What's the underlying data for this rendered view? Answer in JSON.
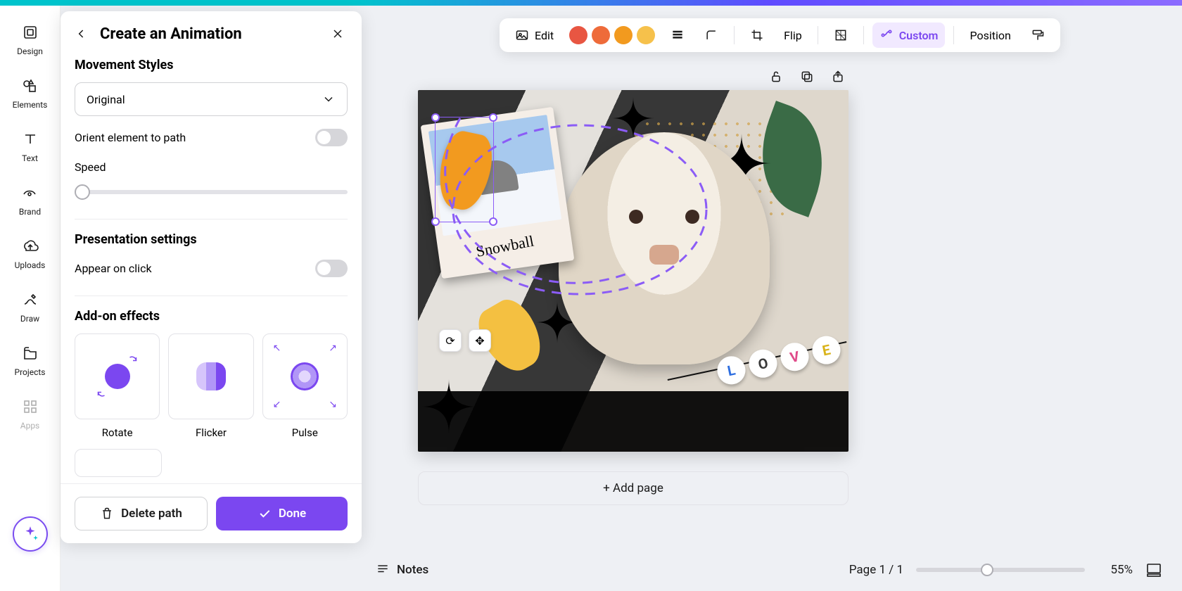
{
  "rail": {
    "design": "Design",
    "elements": "Elements",
    "text": "Text",
    "brand": "Brand",
    "uploads": "Uploads",
    "draw": "Draw",
    "projects": "Projects",
    "apps": "Apps"
  },
  "panel": {
    "title": "Create an Animation",
    "movement_styles": "Movement Styles",
    "style_selected": "Original",
    "orient_label": "Orient element to path",
    "speed_label": "Speed",
    "presentation_settings": "Presentation settings",
    "appear_on_click": "Appear on click",
    "addon_effects": "Add-on effects",
    "effects": {
      "rotate": "Rotate",
      "flicker": "Flicker",
      "pulse": "Pulse"
    },
    "delete_path": "Delete path",
    "done": "Done"
  },
  "context_bar": {
    "edit": "Edit",
    "swatches": [
      "#e85642",
      "#ee6b3a",
      "#f29a1f",
      "#f6c14b"
    ],
    "flip": "Flip",
    "custom": "Custom",
    "position": "Position"
  },
  "canvas": {
    "polaroid_caption": "Snowball",
    "beads": [
      "L",
      "O",
      "V",
      "E"
    ],
    "bead_colors": [
      "#2f6fe0",
      "#3a3a3a",
      "#e04b8a",
      "#d9b31a"
    ]
  },
  "add_page": "+ Add page",
  "bottom": {
    "notes": "Notes",
    "page_indicator": "Page 1 / 1",
    "zoom_pct": "55%"
  }
}
